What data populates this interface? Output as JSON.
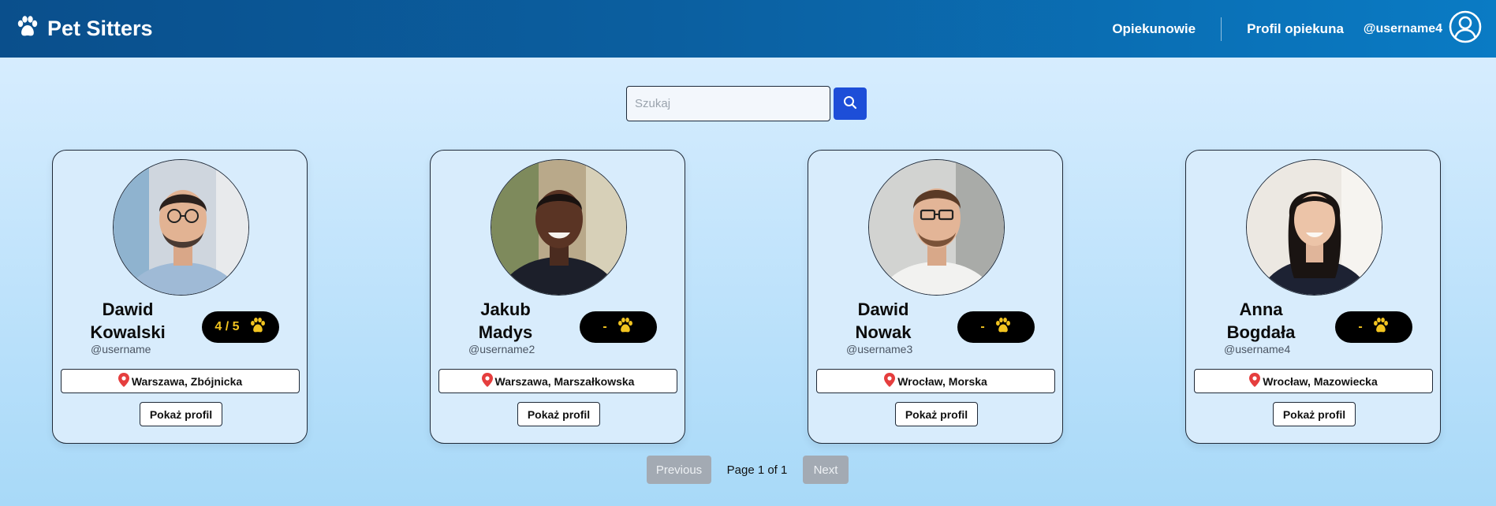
{
  "nav": {
    "brand": "Pet Sitters",
    "links": [
      "Opiekunowie",
      "Profil opiekuna"
    ],
    "username": "@username4"
  },
  "search": {
    "placeholder": "Szukaj"
  },
  "sitters": [
    {
      "first": "Dawid",
      "last": "Kowalski",
      "handle": "@username",
      "rating": "4 / 5",
      "location": "Warszawa, Zbójnicka",
      "button": "Pokaż profil"
    },
    {
      "first": "Jakub",
      "last": "Madys",
      "handle": "@username2",
      "rating": "-",
      "location": "Warszawa, Marszałkowska",
      "button": "Pokaż profil"
    },
    {
      "first": "Dawid",
      "last": "Nowak",
      "handle": "@username3",
      "rating": "-",
      "location": "Wrocław, Morska",
      "button": "Pokaż profil"
    },
    {
      "first": "Anna",
      "last": "Bogdała",
      "handle": "@username4",
      "rating": "-",
      "location": "Wrocław, Mazowiecka",
      "button": "Pokaż profil"
    }
  ],
  "pagination": {
    "prev": "Previous",
    "info": "Page 1 of 1",
    "next": "Next"
  },
  "colors": {
    "accent": "#1d4ed8",
    "rating_text": "#f2c420",
    "pin": "#e53e3e"
  }
}
